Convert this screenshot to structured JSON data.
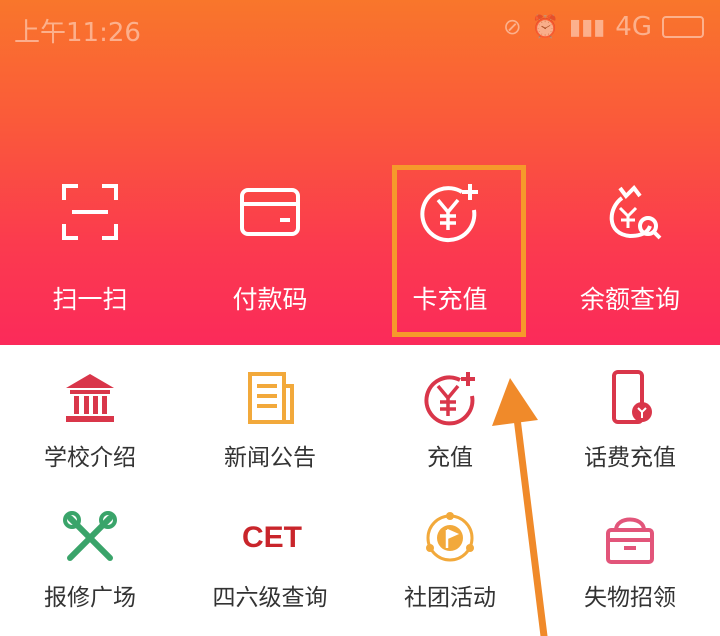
{
  "status_bar": {
    "time": "上午11:26",
    "network": "4G"
  },
  "top_actions": [
    {
      "label": "扫一扫",
      "icon": "scan-icon"
    },
    {
      "label": "付款码",
      "icon": "card-icon"
    },
    {
      "label": "卡充值",
      "icon": "yuan-plus-icon"
    },
    {
      "label": "余额查询",
      "icon": "money-bag-search-icon"
    }
  ],
  "services": [
    {
      "label": "学校介绍",
      "icon": "school-building-icon"
    },
    {
      "label": "新闻公告",
      "icon": "news-icon"
    },
    {
      "label": "充值",
      "icon": "yuan-plus-icon"
    },
    {
      "label": "话费充值",
      "icon": "phone-recharge-icon"
    },
    {
      "label": "报修广场",
      "icon": "repair-tools-icon"
    },
    {
      "label": "四六级查询",
      "icon": "cet-icon",
      "badge": "CET"
    },
    {
      "label": "社团活动",
      "icon": "club-activity-icon"
    },
    {
      "label": "失物招领",
      "icon": "lost-found-icon"
    }
  ],
  "colors": {
    "header_top": "#f9762b",
    "header_bottom": "#fb2a5a",
    "highlight": "#f6992b",
    "arrow": "#f08a2a"
  }
}
